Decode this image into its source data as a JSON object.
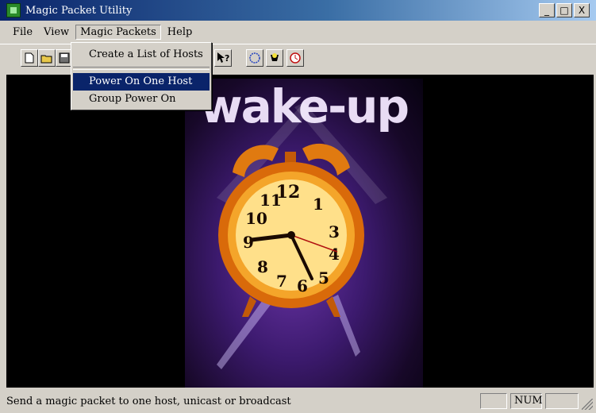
{
  "window": {
    "title": "Magic Packet Utility"
  },
  "window_buttons": [
    "_",
    "□",
    "X"
  ],
  "menubar": {
    "items": [
      "File",
      "View",
      "Magic Packets",
      "Help"
    ]
  },
  "dropdown": {
    "items": [
      {
        "label": "Create a List of Hosts",
        "highlighted": false
      },
      {
        "label": "Power On One Host",
        "highlighted": true
      },
      {
        "label": "Group Power On",
        "highlighted": false
      }
    ]
  },
  "toolbar": {
    "buttons": [
      "new-file-icon",
      "open-folder-icon",
      "save-icon",
      "help-pointer-icon",
      "power-circle-icon",
      "wake-host-icon",
      "clock-icon"
    ]
  },
  "canvas": {
    "poster_title": "wake-up"
  },
  "statusbar": {
    "message": "Send a magic packet to one host, unicast or broadcast",
    "num": "NUM"
  },
  "colors": {
    "titlebar": "#0a246a",
    "highlight": "#0a246a",
    "face": "#d4d0c8",
    "canvas": "#000000",
    "clock_body": "#e07a10"
  }
}
